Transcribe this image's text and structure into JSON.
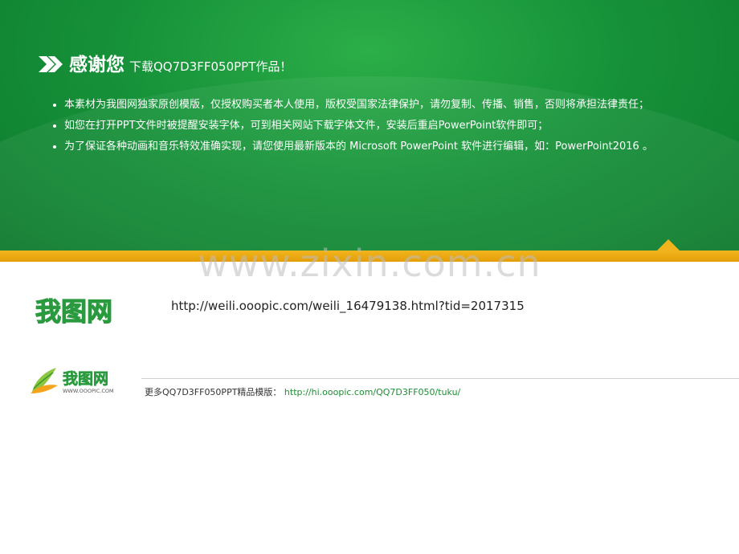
{
  "header": {
    "title_main": "感谢您",
    "title_sub": "下载QQ7D3FF050PPT作品！"
  },
  "notes": [
    "本素材为我图网独家原创模版，仅授权购买者本人使用，版权受国家法律保护，请勿复制、传播、销售，否则将承担法律责任；",
    "如您在打开PPT文件时被提醒安装字体，可到相关网站下载字体文件，安装后重启PowerPoint软件即可；",
    "为了保证各种动画和音乐特效准确实现，请您使用最新版本的 Microsoft PowerPoint 软件进行编辑，如：PowerPoint2016 。"
  ],
  "watermark": "www.zixin.com.cn",
  "logo": {
    "text": "我图网",
    "domain": "WWW.OOOPIC.COM"
  },
  "main_url": "http://weili.ooopic.com/weili_16479138.html?tid=2017315",
  "more": {
    "label": "更多QQ7D3FF050PPT精品模版：",
    "link": "http://hi.ooopic.com/QQ7D3FF050/tuku/"
  },
  "colors": {
    "banner_green": "#17933a",
    "band_gold": "#f2b41c",
    "logo_green": "#2a9a3e",
    "link_green": "#1e8f34"
  }
}
